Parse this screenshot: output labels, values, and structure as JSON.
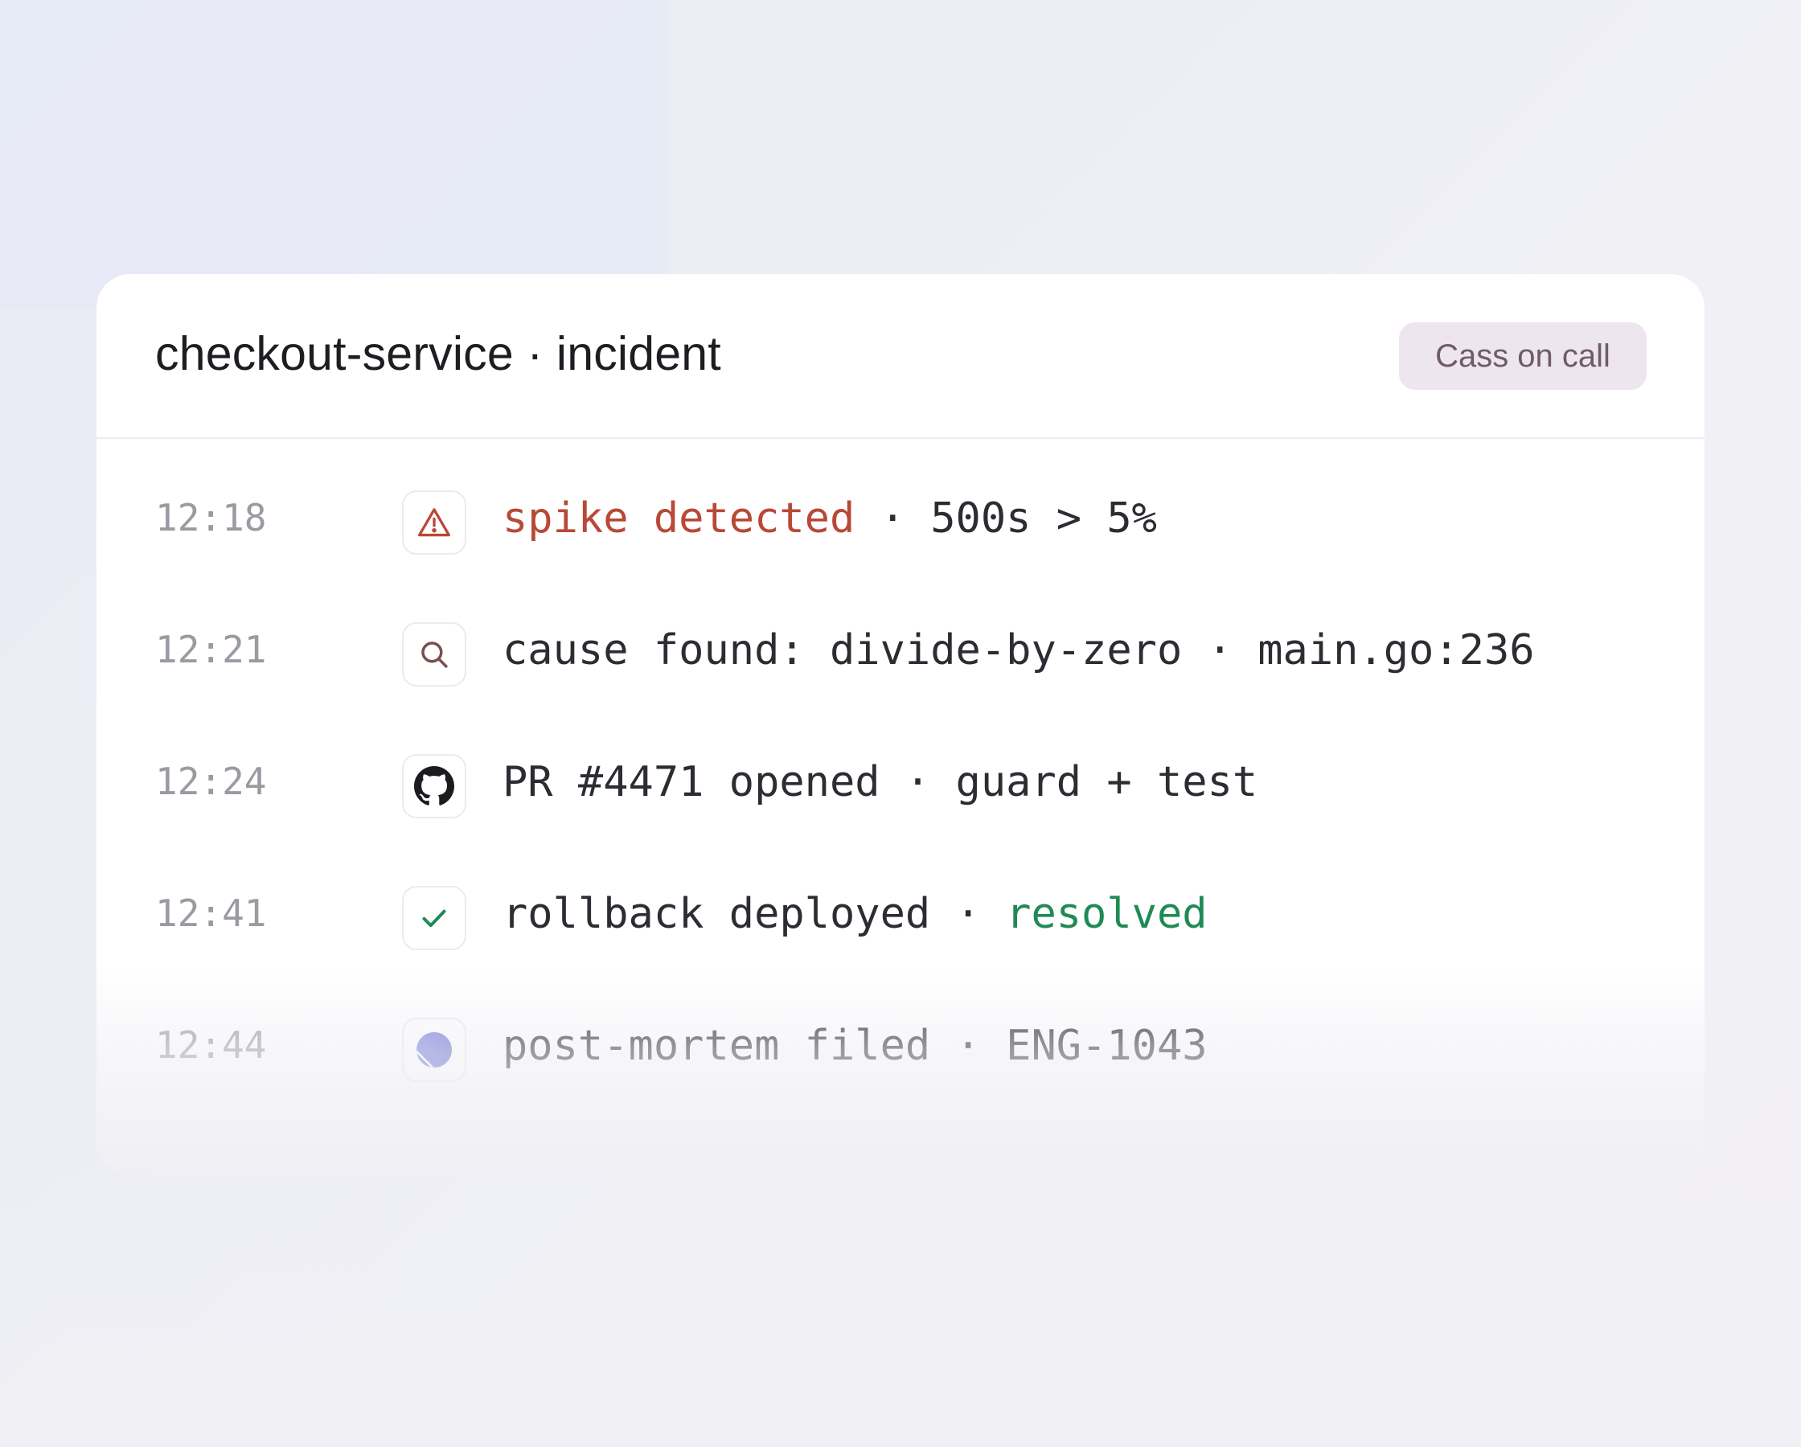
{
  "header": {
    "title": "checkout-service · incident",
    "badge": "Cass on call"
  },
  "timeline": [
    {
      "time": "12:18",
      "icon": "warning-triangle-icon",
      "parts": [
        {
          "text": "spike detected",
          "style": "red"
        },
        {
          "text": " · 500s > 5%",
          "style": "normal"
        }
      ]
    },
    {
      "time": "12:21",
      "icon": "search-icon",
      "parts": [
        {
          "text": "cause found: ",
          "style": "normal"
        },
        {
          "text": "divide-by-zero · main.go:236",
          "style": "normal"
        }
      ]
    },
    {
      "time": "12:24",
      "icon": "github-icon",
      "parts": [
        {
          "text": "PR #4471 opened · guard + test",
          "style": "normal"
        }
      ]
    },
    {
      "time": "12:41",
      "icon": "check-icon",
      "parts": [
        {
          "text": "rollback deployed · ",
          "style": "normal"
        },
        {
          "text": "resolved",
          "style": "green"
        }
      ]
    },
    {
      "time": "12:44",
      "icon": "linear-logo-icon",
      "parts": [
        {
          "text": "post-mortem filed · ENG-1043",
          "style": "normal"
        }
      ]
    }
  ],
  "colors": {
    "alert": "#b94837",
    "success": "#1f8a55",
    "badge_bg": "#eee6ee"
  }
}
